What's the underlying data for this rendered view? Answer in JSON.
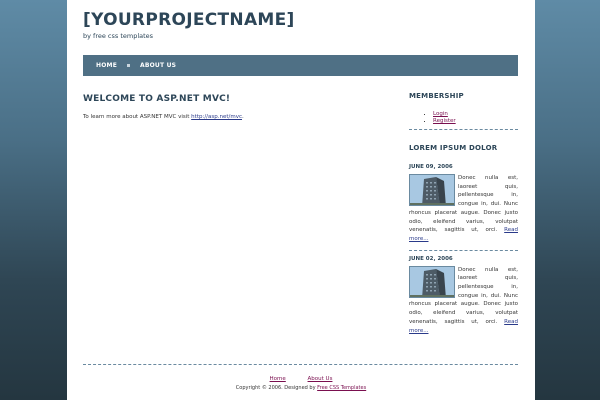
{
  "header": {
    "title": "[YOURPROJECTNAME]",
    "tagline": "by free css templates"
  },
  "menu": {
    "items": [
      {
        "label": "HOME"
      },
      {
        "label": "ABOUT US"
      }
    ]
  },
  "main": {
    "heading": "WELCOME TO ASP.NET MVC!",
    "intro_text": "To learn more about ASP.NET MVC visit",
    "intro_link": "http://asp.net/mvc",
    "intro_suffix": "."
  },
  "sidebar": {
    "membership": {
      "title": "MEMBERSHIP",
      "links": [
        "Login",
        "Register"
      ]
    },
    "news": {
      "title": "LOREM IPSUM DOLOR",
      "items": [
        {
          "date": "JUNE 09, 2006",
          "body": "Donec nulla est, laoreet quis, pellentesque in, congue in, dui. Nunc rhoncus placerat augue. Donec justo odio, eleifend varius, volutpat venenatis, sagittis ut, orci.",
          "read_more": "Read more..."
        },
        {
          "date": "JUNE 02, 2006",
          "body": "Donec nulla est, laoreet quis, pellentesque in, congue in, dui. Nunc rhoncus placerat augue. Donec justo odio, eleifend varius, volutpat venenatis, sagittis ut, orci.",
          "read_more": "Read more..."
        }
      ]
    }
  },
  "footer": {
    "links": [
      "Home",
      "About Us"
    ],
    "copyright_text": "Copyright © 2006. Designed by",
    "designer_link": "Free CSS Templates"
  },
  "colors": {
    "brand": "#2d4658",
    "menu_bg": "#4f7085",
    "visited_link": "#7a0f4f"
  }
}
